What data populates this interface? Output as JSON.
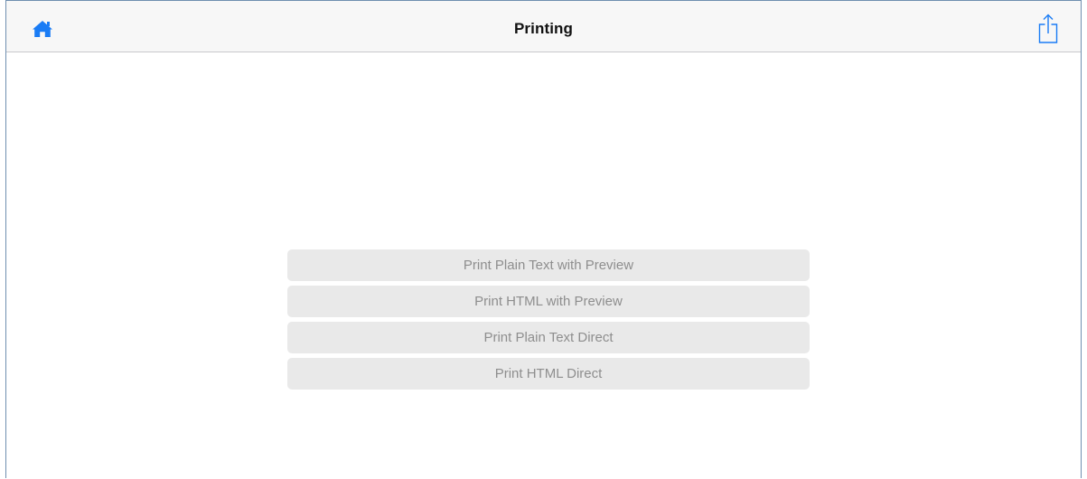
{
  "navbar": {
    "title": "Printing",
    "left_icon": "home-icon",
    "right_icon": "share-icon",
    "accent_color": "#1a7cf5"
  },
  "buttons": [
    {
      "label": "Print Plain Text with Preview"
    },
    {
      "label": "Print HTML with Preview"
    },
    {
      "label": "Print Plain Text Direct"
    },
    {
      "label": "Print HTML Direct"
    }
  ]
}
